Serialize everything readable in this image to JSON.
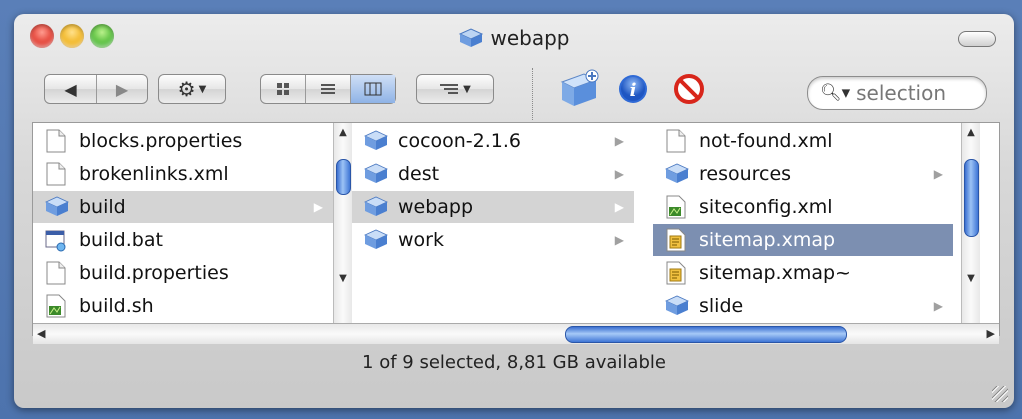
{
  "window": {
    "title": "webapp"
  },
  "toolbar": {
    "back_icon": "back-arrow-icon",
    "forward_icon": "forward-arrow-icon",
    "action_icon": "gear-icon",
    "view_icons": [
      "icon-view-icon",
      "list-view-icon",
      "column-view-icon"
    ],
    "arrange_icon": "arrange-icon",
    "new_folder_icon": "new-folder-icon",
    "info_icon": "info-icon",
    "delete_icon": "no-entry-icon",
    "search_placeholder": "selection"
  },
  "columns": [
    {
      "items": [
        {
          "label": "blocks.properties",
          "icon": "document-icon",
          "folder": false
        },
        {
          "label": "brokenlinks.xml",
          "icon": "document-icon",
          "folder": false
        },
        {
          "label": "build",
          "icon": "folder-icon",
          "folder": true,
          "selected": "grey"
        },
        {
          "label": "build.bat",
          "icon": "batch-file-icon",
          "folder": false
        },
        {
          "label": "build.properties",
          "icon": "document-icon",
          "folder": false
        },
        {
          "label": "build.sh",
          "icon": "script-icon",
          "folder": false
        }
      ]
    },
    {
      "items": [
        {
          "label": "cocoon-2.1.6",
          "icon": "folder-icon",
          "folder": true
        },
        {
          "label": "dest",
          "icon": "folder-icon",
          "folder": true
        },
        {
          "label": "webapp",
          "icon": "folder-icon",
          "folder": true,
          "selected": "grey"
        },
        {
          "label": "work",
          "icon": "folder-icon",
          "folder": true
        }
      ]
    },
    {
      "items": [
        {
          "label": "not-found.xml",
          "icon": "document-icon",
          "folder": false
        },
        {
          "label": "resources",
          "icon": "folder-icon",
          "folder": true
        },
        {
          "label": "siteconfig.xml",
          "icon": "script-icon",
          "folder": false
        },
        {
          "label": "sitemap.xmap",
          "icon": "xmap-file-icon",
          "folder": false,
          "selected": "blue"
        },
        {
          "label": "sitemap.xmap~",
          "icon": "xmap-file-icon",
          "folder": false
        },
        {
          "label": "slide",
          "icon": "folder-icon",
          "folder": true
        }
      ]
    }
  ],
  "status": {
    "text": "1 of 9 selected, 8,81 GB available"
  }
}
